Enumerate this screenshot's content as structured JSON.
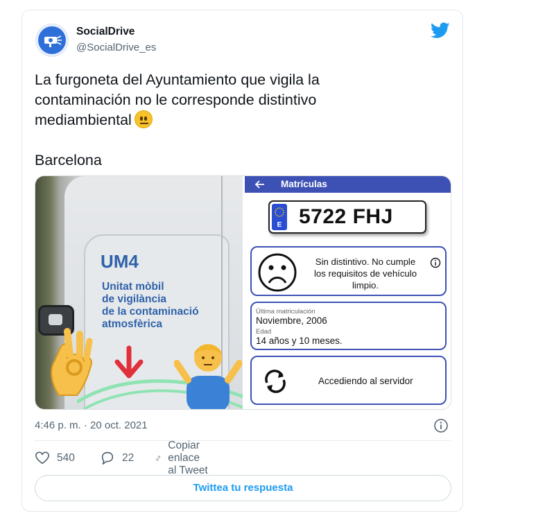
{
  "tweet": {
    "author": {
      "display_name": "SocialDrive",
      "handle": "@SocialDrive_es",
      "avatar_icon": "speed-camera-icon",
      "brand_color": "#2f6fd8"
    },
    "text": "La furgoneta del Ayuntamiento que vigila la\ncontaminación no le corresponde distintivo\nmediambiental",
    "emoji": "neutral-face-emoji",
    "location_line": "Barcelona",
    "timestamp": "4:46 p. m. · 20 oct. 2021",
    "twitter_icon": "twitter-bird-icon",
    "twitter_color": "#1d9bf0"
  },
  "media": {
    "van": {
      "code": "UM4",
      "lettering": "Unitat mòbil\nde vigilància\nde la contaminació\natmosfèrica",
      "emojis": [
        "ok-hand-emoji",
        "down-arrow-emoji",
        "shrugging-person-emoji"
      ]
    },
    "app": {
      "header_title": "Matrículas",
      "header_color": "#3d51b5",
      "plate": {
        "country": "E",
        "number": "5722 FHJ"
      },
      "status_text": "Sin distintivo. No cumple\nlos requisitos de vehículo\nlimpio.",
      "last_registration_label": "Última matriculación",
      "last_registration_value": "Noviembre, 2006",
      "age_label": "Edad",
      "age_value": "14 años y 10 meses.",
      "server_text": "Accediendo al servidor"
    }
  },
  "actions": {
    "likes": "540",
    "replies": "22",
    "copy_link": "Copiar enlace al Tweet",
    "reply_button": "Twittea tu respuesta"
  }
}
